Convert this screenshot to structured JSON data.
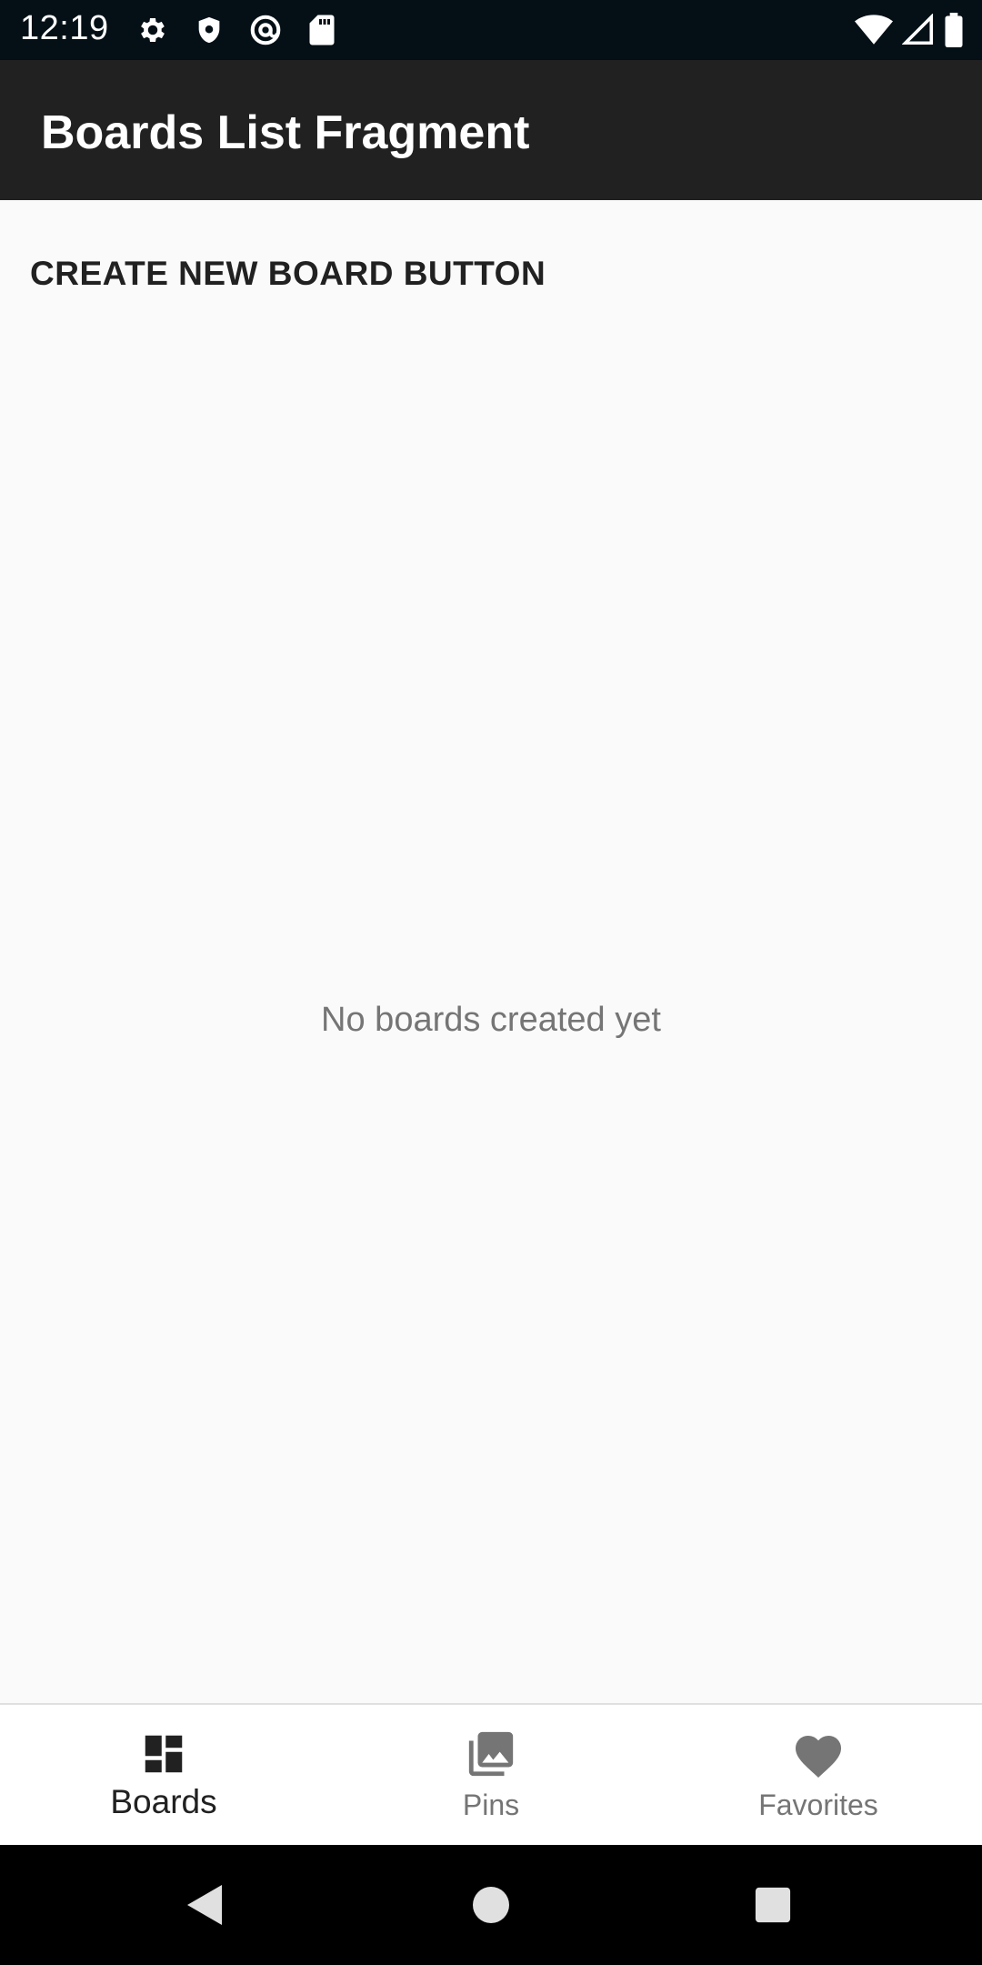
{
  "status_bar": {
    "time": "12:19",
    "left_icons": [
      "gear-icon",
      "shield-icon",
      "at-sign-icon",
      "sd-card-icon"
    ],
    "right_icons": [
      "wifi-icon",
      "signal-icon",
      "battery-icon"
    ]
  },
  "app_bar": {
    "title": "Boards List Fragment"
  },
  "content": {
    "create_button_label": "CREATE NEW BOARD BUTTON",
    "empty_message": "No boards created yet"
  },
  "bottom_nav": {
    "items": [
      {
        "label": "Boards",
        "icon": "dashboard-icon",
        "active": true
      },
      {
        "label": "Pins",
        "icon": "photo-library-icon",
        "active": false
      },
      {
        "label": "Favorites",
        "icon": "heart-icon",
        "active": false
      }
    ]
  },
  "system_nav": {
    "buttons": [
      "back-icon",
      "home-icon",
      "recents-icon"
    ]
  },
  "colors": {
    "status_bar_bg": "#041016",
    "app_bar_bg": "#212121",
    "content_bg": "#fafafa",
    "active_nav": "#212121",
    "inactive_nav": "#757575"
  }
}
